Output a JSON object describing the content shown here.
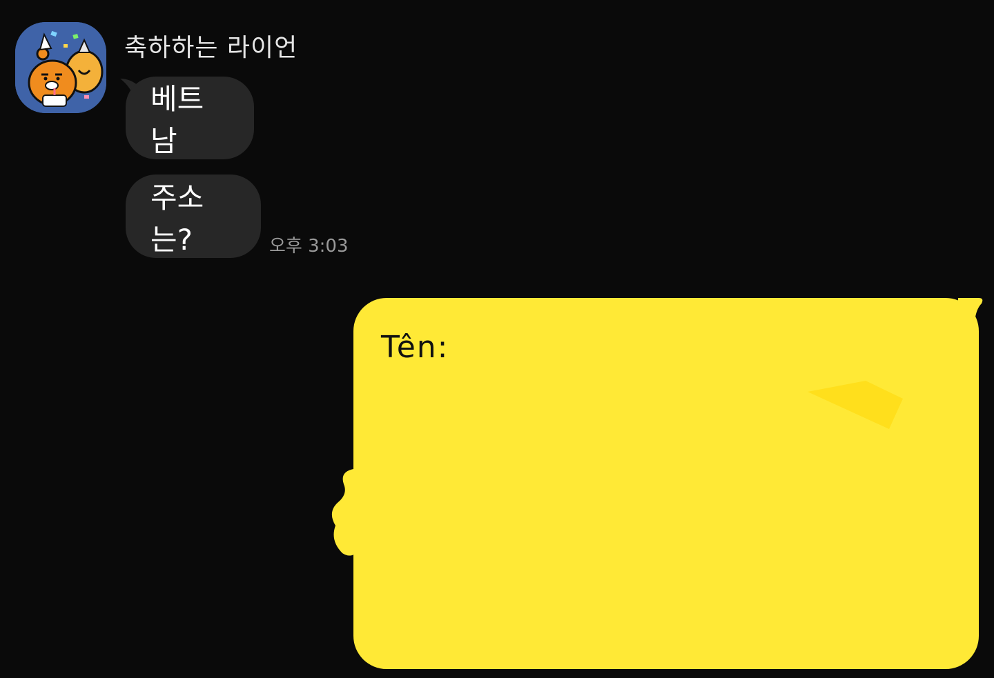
{
  "chat": {
    "sender": {
      "name": "축하하는 라이언",
      "avatar_icon": "ryan-celebrating-avatar-icon"
    },
    "incoming_messages": [
      {
        "text": "베트남"
      },
      {
        "text": "주소는?"
      }
    ],
    "timestamp": "오후 3:03",
    "outgoing_message": {
      "text": "Tên:"
    }
  },
  "colors": {
    "background": "#0a0a0a",
    "incoming_bubble": "#272727",
    "outgoing_bubble": "#ffe936",
    "avatar_bg": "#3f63a8"
  }
}
